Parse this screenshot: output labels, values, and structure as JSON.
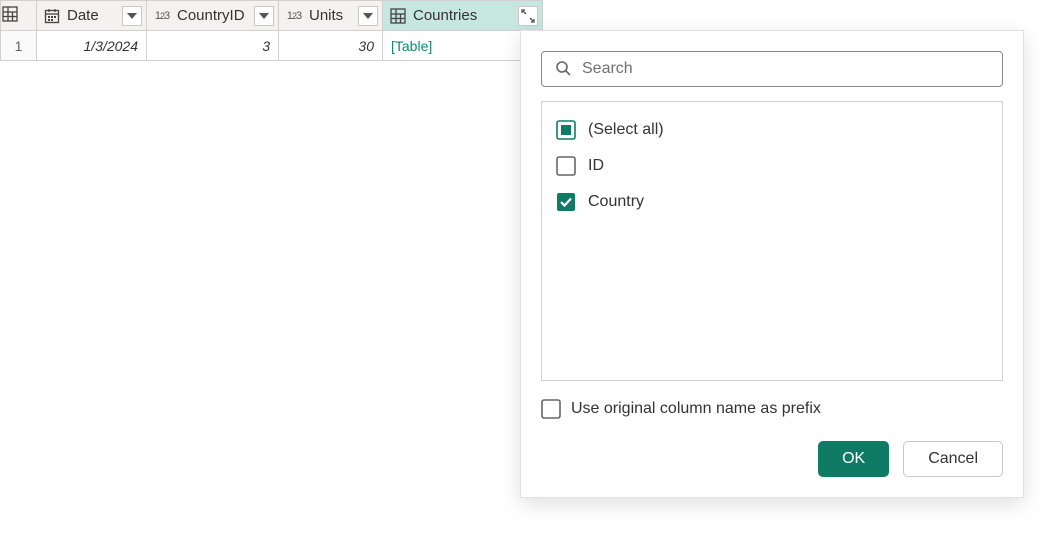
{
  "columns": {
    "date": {
      "label": "Date"
    },
    "countryid": {
      "label": "CountryID"
    },
    "units": {
      "label": "Units"
    },
    "countries": {
      "label": "Countries"
    }
  },
  "rows": [
    {
      "index": "1",
      "date": "1/3/2024",
      "countryid": "3",
      "units": "30",
      "countries": "[Table]"
    }
  ],
  "popup": {
    "search_placeholder": "Search",
    "select_all_label": "(Select all)",
    "fields": [
      {
        "name": "ID",
        "checked": false
      },
      {
        "name": "Country",
        "checked": true
      }
    ],
    "prefix_label": "Use original column name as prefix",
    "ok_label": "OK",
    "cancel_label": "Cancel"
  }
}
